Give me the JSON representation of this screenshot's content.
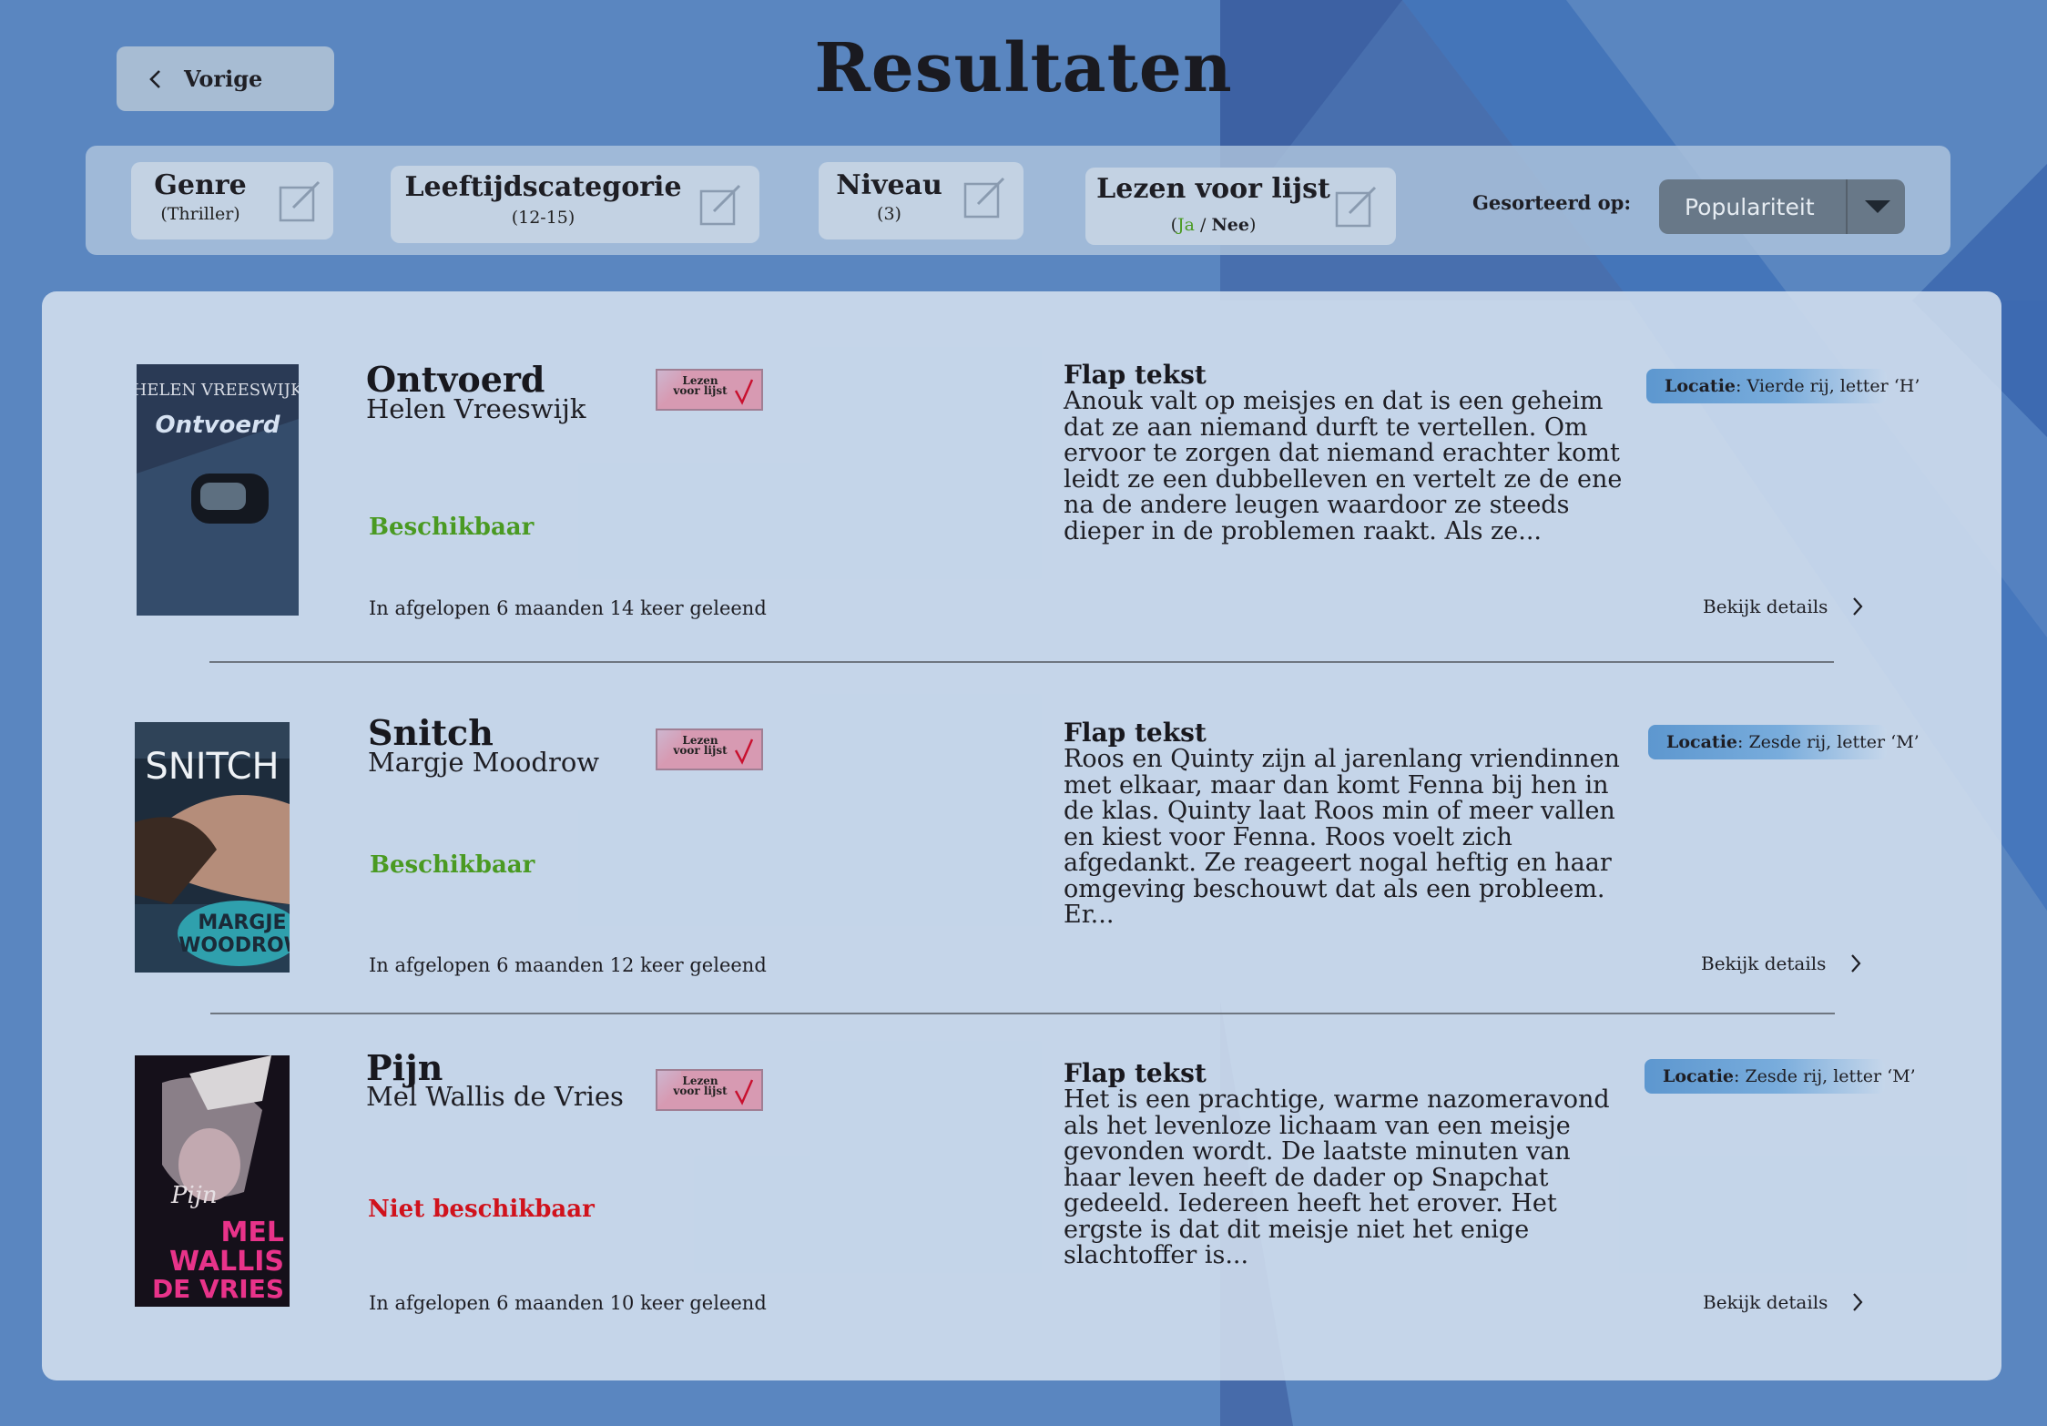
{
  "header": {
    "back_label": "Vorige",
    "title": "Resultaten"
  },
  "filters": [
    {
      "title": "Genre",
      "value": "(Thriller)"
    },
    {
      "title": "Leeftijdscategorie",
      "value": "(12-15)"
    },
    {
      "title": "Niveau",
      "value": "(3)"
    },
    {
      "title": "Lezen voor lijst",
      "value_open": "(",
      "value_yes": "Ja",
      "value_sep": " / ",
      "value_no": "Nee",
      "value_close": ")"
    }
  ],
  "sort": {
    "label": "Gesorteerd op:",
    "selected": "Populariteit"
  },
  "results": [
    {
      "title": "Ontvoerd",
      "author": "Helen Vreeswijk",
      "reading_list_badge": "Lezen voor lijst",
      "availability": "Beschikbaar",
      "available": true,
      "borrowed": "In afgelopen 6 maanden 14 keer geleend",
      "flap_heading": "Flap tekst",
      "flap_text": "Anouk valt op meisjes en dat is een geheim dat ze aan niemand durft te vertellen. Om ervoor te zorgen dat niemand erachter komt leidt ze een dubbelleven en vertelt ze de ene na de andere leugen waardoor ze steeds dieper in de problemen raakt. Als ze...",
      "location_label": "Locatie",
      "location_value": ": Vierde rij, letter ‘H’",
      "details_label": "Bekijk details",
      "cover": {
        "author_text": "HELEN VREESWIJK",
        "title_text": "Ontvoerd"
      }
    },
    {
      "title": "Snitch",
      "author": "Margje Moodrow",
      "reading_list_badge": "Lezen voor lijst",
      "availability": "Beschikbaar",
      "available": true,
      "borrowed": "In afgelopen 6 maanden 12 keer geleend",
      "flap_heading": "Flap tekst",
      "flap_text": "Roos en Quinty zijn al jarenlang vriendinnen met elkaar, maar dan komt Fenna bij hen in de klas. Quinty laat Roos min of meer vallen en kiest voor Fenna. Roos voelt zich afgedankt. Ze reageert nogal heftig en haar omgeving beschouwt dat als een probleem. Er...",
      "location_label": "Locatie",
      "location_value": ": Zesde rij, letter ‘M’",
      "details_label": "Bekijk details",
      "cover": {
        "title_text": "SNITCH",
        "author_line1": "MARGJE",
        "author_line2": "WOODROW"
      }
    },
    {
      "title": "Pijn",
      "author": "Mel Wallis de Vries",
      "reading_list_badge": "Lezen voor lijst",
      "availability": "Niet beschikbaar",
      "available": false,
      "borrowed": "In afgelopen 6 maanden 10 keer geleend",
      "flap_heading": "Flap tekst",
      "flap_text": "Het is een prachtige, warme nazomeravond als het levenloze lichaam van een meisje gevonden wordt. De laatste minuten van haar leven heeft de dader op Snapchat gedeeld. Iedereen heeft het erover. Het ergste is dat dit meisje niet het enige slachtoffer is...",
      "location_label": "Locatie",
      "location_value": ": Zesde rij, letter ‘M’",
      "details_label": "Bekijk details",
      "cover": {
        "title_text": "Pijn",
        "author_line1": "MEL",
        "author_line2": "WALLIS",
        "author_line3": "DE VRIES"
      }
    }
  ],
  "colors": {
    "background": "#5a86c0",
    "available": "#4a9a22",
    "unavailable": "#d0121c",
    "badge": "#d79ab2",
    "location": "#5d97cf",
    "sort_select": "#687888"
  },
  "icons": {
    "back": "chevron-left-icon",
    "edit": "edit-icon",
    "dropdown": "triangle-down-icon",
    "details": "chevron-right-icon",
    "check": "checkmark-icon"
  }
}
